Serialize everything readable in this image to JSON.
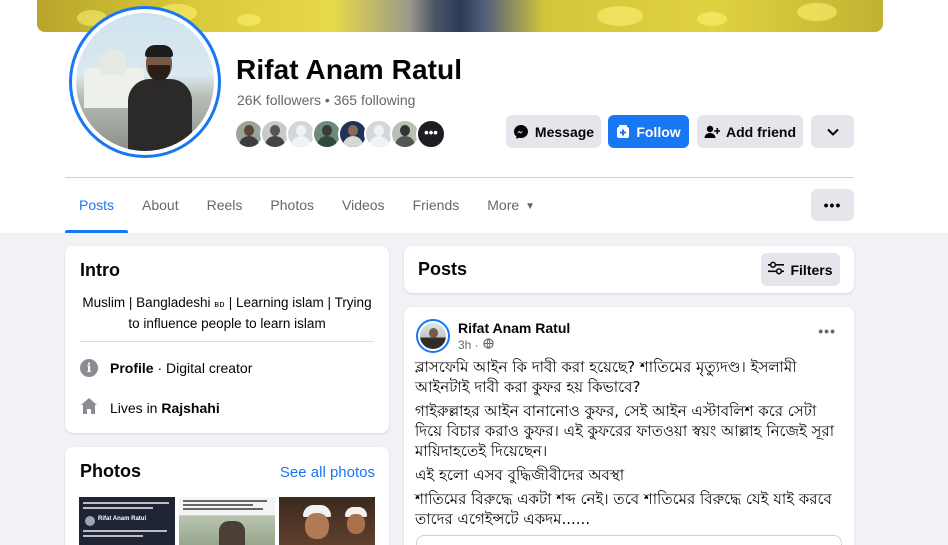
{
  "profile": {
    "name": "Rifat Anam Ratul",
    "stats": "26K followers • 365 following",
    "more_friends_glyph": "•••"
  },
  "actions": {
    "message_label": "Message",
    "follow_label": "Follow",
    "add_friend_label": "Add friend"
  },
  "tabs": [
    {
      "label": "Posts"
    },
    {
      "label": "About"
    },
    {
      "label": "Reels"
    },
    {
      "label": "Photos"
    },
    {
      "label": "Videos"
    },
    {
      "label": "Friends"
    },
    {
      "label": "More"
    }
  ],
  "tab_dots": "•••",
  "intro": {
    "title": "Intro",
    "bio_part1": "Muslim | Bangladeshi ",
    "bio_bd": "ʙᴅ",
    "bio_part2": " | Learning islam | Trying to influence people to learn islam",
    "profile_label": "Profile",
    "profile_value": " · Digital creator",
    "lives_prefix": "Lives in ",
    "lives_city": "Rajshahi"
  },
  "photos": {
    "title": "Photos",
    "see_all": "See all photos",
    "thumb1_author": "Rifat Anam Ratul"
  },
  "posts": {
    "title": "Posts",
    "filters_label": "Filters"
  },
  "post": {
    "author": "Rifat Anam Ratul",
    "time": "3h ·",
    "menu_glyph": "•••",
    "paragraphs": [
      "ব্লাসফেমি আইন কি দাবী করা হয়েছে? শাতিমের মৃত্যুদণ্ড। ইসলামী আইনটাই দাবী করা কুফর হয় কিভাবে?",
      "গাইরুল্লাহর আইন বানানোও কুফর, সেই আইন এস্টাবলিশ করে সেটা দিয়ে বিচার করাও কুফর। এই কুফরের ফাতওয়া স্বয়ং আল্লাহ নিজেই সূরা মায়িদাহতেই দিয়েছেন।",
      "এই হলো এসব বুদ্ধিজীবীদের অবস্থা",
      "শাতিমের বিরুদ্ধে একটা শব্দ নেই। তবে শাতিমের বিরুদ্ধে যেই যাই করবে তাদের এগেইন্সটে একদম......"
    ]
  },
  "colors": {
    "accent": "#1877f2",
    "background": "#f0f2f5",
    "button_gray": "#e4e6eb",
    "secondary_text": "#65676b"
  },
  "icons": {
    "message": "messenger-icon",
    "follow": "follow-plus-icon",
    "add_friend": "add-friend-icon",
    "dropdown": "chevron-down-icon",
    "filters": "sliders-icon",
    "profile_info": "info-icon",
    "lives": "home-icon",
    "privacy": "globe-icon"
  }
}
